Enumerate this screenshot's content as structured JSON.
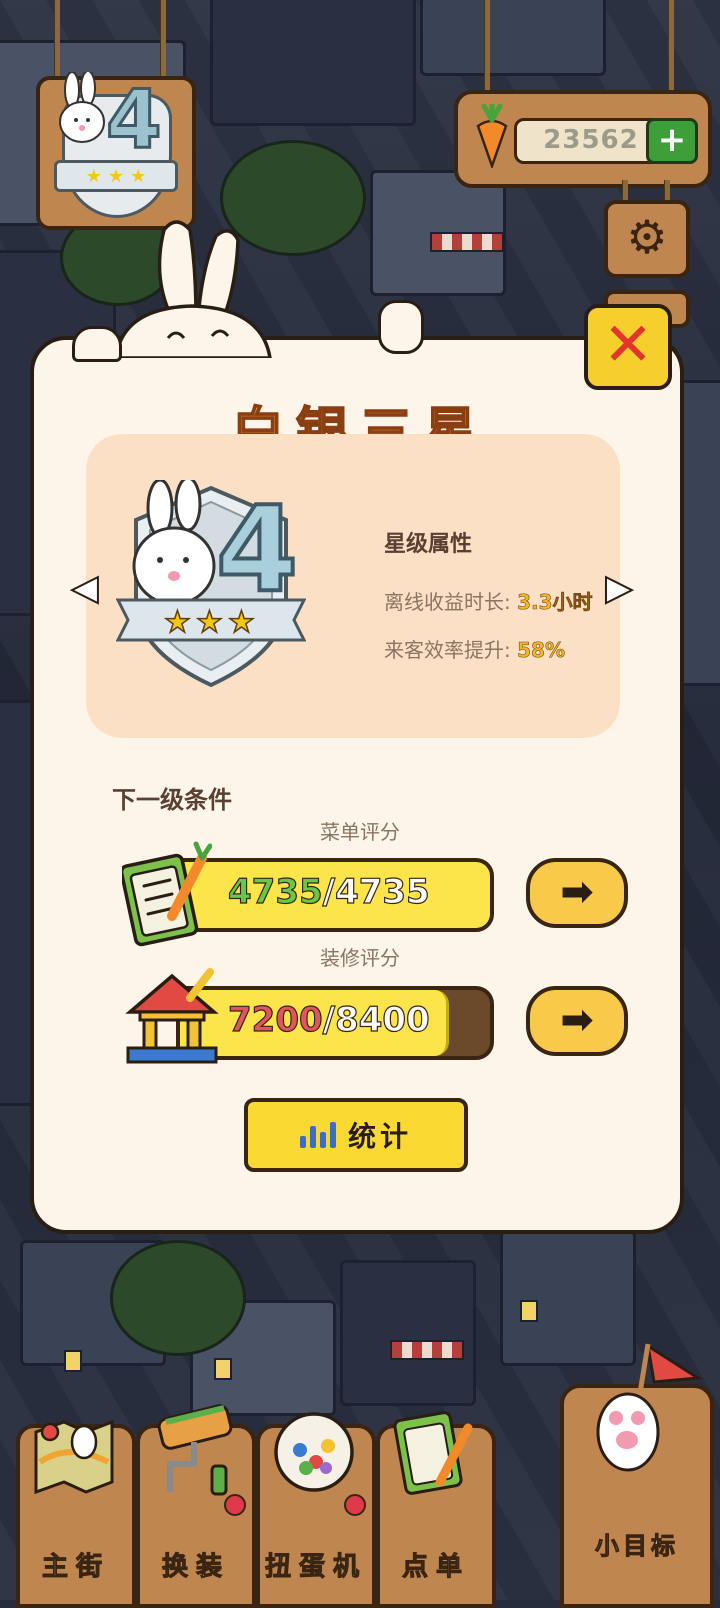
{
  "hud": {
    "carrot_amount": "23562",
    "add_label": "+",
    "level_number": "4",
    "settings_glyph": "⚙"
  },
  "popup": {
    "title": "白银三星",
    "close_glyph": "✕",
    "attributes_title": "星级属性",
    "attributes": [
      {
        "label": "离线收益时长:",
        "value": "3.3小时"
      },
      {
        "label": "来客效率提升:",
        "value": "58%"
      }
    ],
    "badge_number": "4",
    "badge_stars": "★ ★ ★",
    "next_level_title": "下一级条件",
    "conditions": [
      {
        "label": "菜单评分",
        "current": "4735",
        "separator": "/",
        "target": "4735",
        "progress": 1.0,
        "met": true
      },
      {
        "label": "装修评分",
        "current": "7200",
        "separator": "/",
        "target": "8400",
        "progress": 0.857,
        "met": false
      }
    ],
    "go_glyph": "➡",
    "stats_button": "统计",
    "prev_glyph": "◀",
    "next_glyph": "▶"
  },
  "nav": [
    {
      "label": "主街",
      "icon": "map-icon",
      "dot": false
    },
    {
      "label": "换装",
      "icon": "paint-roller-icon",
      "dot": true
    },
    {
      "label": "扭蛋机",
      "icon": "gacha-machine-icon",
      "dot": true
    },
    {
      "label": "点单",
      "icon": "order-list-icon",
      "dot": false
    },
    {
      "label": "小目标",
      "icon": "goal-flag-icon",
      "dot": false
    }
  ],
  "colors": {
    "panel_bg": "#fdf5ea",
    "title_orange": "#f0a431",
    "value_yellow": "#f0b82a",
    "met_green": "#68c84a",
    "unmet_red": "#e0565c",
    "wood": "#c08650"
  }
}
